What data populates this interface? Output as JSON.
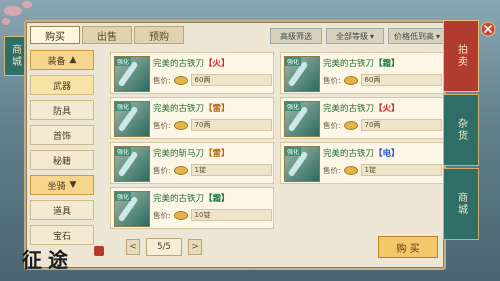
{
  "side_tab": {
    "label": "商城"
  },
  "tabs": [
    {
      "label": "购买",
      "active": true
    },
    {
      "label": "出售",
      "active": false
    },
    {
      "label": "预购",
      "active": false
    }
  ],
  "filters": {
    "advanced": "高级筛选",
    "level": "全部等级",
    "sort": "价格低到高"
  },
  "sidebar": {
    "items": [
      {
        "label": "装备",
        "type": "category",
        "icon": "chevron-up-icon"
      },
      {
        "label": "武器",
        "type": "selected"
      },
      {
        "label": "防具",
        "type": "item"
      },
      {
        "label": "首饰",
        "type": "item"
      },
      {
        "label": "秘籍",
        "type": "item"
      },
      {
        "label": "坐骑",
        "type": "category",
        "icon": "chevron-down-icon"
      },
      {
        "label": "道具",
        "type": "item"
      },
      {
        "label": "宝石",
        "type": "item"
      }
    ]
  },
  "items": [
    {
      "name": "完美的古铁刀",
      "element": "【火】",
      "element_color": "#d02b2b",
      "price_label": "售价:",
      "price": "60两",
      "badge": "强化"
    },
    {
      "name": "完美的古铁刀",
      "element": "【霜】",
      "element_color": "#1a7c3d",
      "price_label": "售价:",
      "price": "60两",
      "badge": "强化"
    },
    {
      "name": "完美的古铁刀",
      "element": "【雷】",
      "element_color": "#b86a12",
      "price_label": "售价:",
      "price": "70两",
      "badge": "强化"
    },
    {
      "name": "完美的古铁刀",
      "element": "【火】",
      "element_color": "#d02b2b",
      "price_label": "售价:",
      "price": "70两",
      "badge": "强化"
    },
    {
      "name": "完美的斩马刀",
      "element": "【雷】",
      "element_color": "#b86a12",
      "price_label": "售价:",
      "price": "1锭",
      "badge": "强化"
    },
    {
      "name": "完美的古铁刀",
      "element": "【电】",
      "element_color": "#2a55c7",
      "price_label": "售价:",
      "price": "1锭",
      "badge": "强化"
    },
    {
      "name": "完美的古铁刀",
      "element": "【霜】",
      "element_color": "#1a7c3d",
      "price_label": "售价:",
      "price": "10锭",
      "badge": "强化"
    }
  ],
  "pager": {
    "prev": "<",
    "next": ">",
    "page": "5/5"
  },
  "buy_button": {
    "label": "购 买"
  },
  "right_tabs": [
    {
      "label": "拍卖",
      "active": true
    },
    {
      "label": "杂货",
      "active": false
    },
    {
      "label": "商城",
      "active": false
    }
  ],
  "logo": {
    "text": "征途"
  }
}
